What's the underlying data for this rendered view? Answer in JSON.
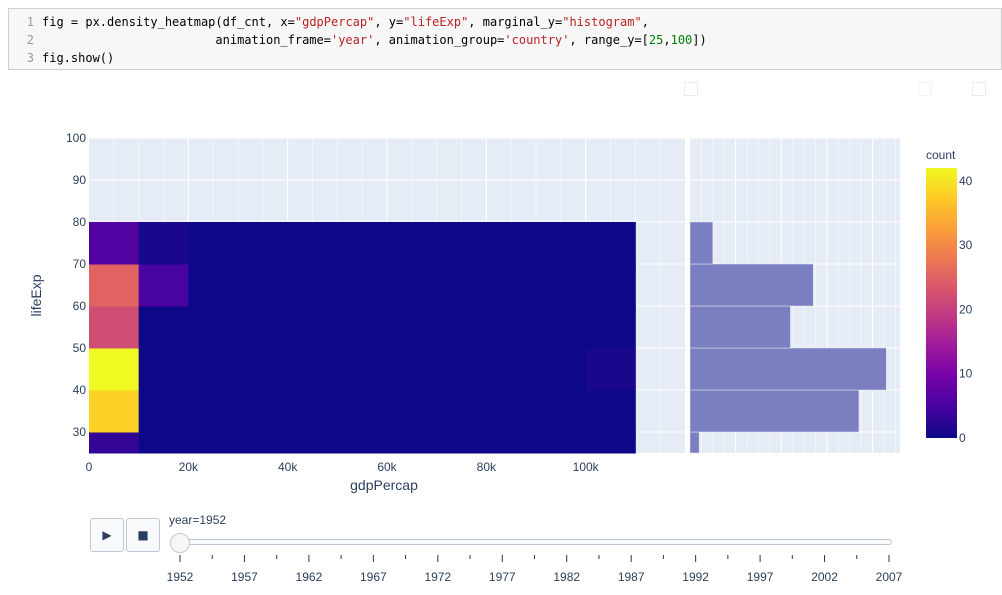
{
  "code_cell": {
    "line_numbers": [
      "1",
      "2",
      "3"
    ],
    "lines": [
      [
        {
          "t": "fig = px.density_heatmap(df_cnt, x="
        },
        {
          "t": "\"gdpPercap\"",
          "c": "str"
        },
        {
          "t": ", y="
        },
        {
          "t": "\"lifeExp\"",
          "c": "str"
        },
        {
          "t": ", marginal_y="
        },
        {
          "t": "\"histogram\"",
          "c": "str"
        },
        {
          "t": ","
        }
      ],
      [
        {
          "t": "                        animation_frame="
        },
        {
          "t": "'year'",
          "c": "str"
        },
        {
          "t": ", animation_group="
        },
        {
          "t": "'country'",
          "c": "str"
        },
        {
          "t": ", range_y=["
        },
        {
          "t": "25",
          "c": "num"
        },
        {
          "t": ","
        },
        {
          "t": "100",
          "c": "num"
        },
        {
          "t": "])"
        }
      ],
      [
        {
          "t": "fig.show()"
        }
      ]
    ]
  },
  "colors": {
    "plot_bg": "#e5ecf6",
    "grid": "#ffffff",
    "text": "#2a3f5f",
    "histogram_bar": "#7b7ec0",
    "colorscale": [
      "#0d0887",
      "#46039f",
      "#7201a8",
      "#9c179e",
      "#bd3786",
      "#d8576b",
      "#ed7953",
      "#fb9f3a",
      "#fdca26",
      "#f0f921"
    ]
  },
  "chart_data": {
    "type": "heatmap",
    "subtype": "density_heatmap with marginal histogram",
    "frame": "year=1952",
    "xlabel": "gdpPercap",
    "ylabel": "lifeExp",
    "xlim": [
      0,
      120000
    ],
    "ylim": [
      25,
      100
    ],
    "x_ticks": [
      {
        "v": 0,
        "label": "0"
      },
      {
        "v": 20000,
        "label": "20k"
      },
      {
        "v": 40000,
        "label": "40k"
      },
      {
        "v": 60000,
        "label": "60k"
      },
      {
        "v": 80000,
        "label": "80k"
      },
      {
        "v": 100000,
        "label": "100k"
      }
    ],
    "y_ticks": [
      {
        "v": 30,
        "label": "30"
      },
      {
        "v": 40,
        "label": "40"
      },
      {
        "v": 50,
        "label": "50"
      },
      {
        "v": 60,
        "label": "60"
      },
      {
        "v": 70,
        "label": "70"
      },
      {
        "v": 80,
        "label": "80"
      },
      {
        "v": 90,
        "label": "90"
      },
      {
        "v": 100,
        "label": "100"
      }
    ],
    "x_bin_edges": [
      0,
      10000,
      20000,
      30000,
      40000,
      50000,
      60000,
      70000,
      80000,
      90000,
      100000,
      110000
    ],
    "y_bin_edges": [
      25,
      30,
      40,
      50,
      60,
      70,
      80
    ],
    "z_rows_bottom_to_top": [
      [
        3,
        0,
        0,
        0,
        0,
        0,
        0,
        0,
        0,
        0,
        0
      ],
      [
        38,
        0,
        0,
        0,
        0,
        0,
        0,
        0,
        0,
        0,
        0
      ],
      [
        42,
        0,
        0,
        0,
        0,
        0,
        0,
        0,
        0,
        0,
        1
      ],
      [
        22,
        0,
        0,
        0,
        0,
        0,
        0,
        0,
        0,
        0,
        0
      ],
      [
        25,
        5,
        0,
        0,
        0,
        0,
        0,
        0,
        0,
        0,
        0
      ],
      [
        6,
        1,
        0,
        0,
        0,
        0,
        0,
        0,
        0,
        0,
        0
      ]
    ],
    "zlim": [
      0,
      42
    ],
    "colorbar": {
      "title": "count",
      "ticks": [
        {
          "v": 0,
          "label": "0"
        },
        {
          "v": 10,
          "label": "10"
        },
        {
          "v": 20,
          "label": "20"
        },
        {
          "v": 30,
          "label": "30"
        },
        {
          "v": 40,
          "label": "40"
        }
      ]
    },
    "marginal_histogram": {
      "bin_edges": [
        25,
        30,
        40,
        50,
        60,
        70,
        80
      ],
      "counts": [
        2,
        37,
        43,
        22,
        27,
        5
      ],
      "xlim": [
        0,
        46
      ],
      "grid": [
        10,
        20,
        30,
        40
      ]
    }
  },
  "animation": {
    "play_glyph": "▶",
    "stop_glyph": "■",
    "current_label": "year=1952",
    "frames": [
      "1952",
      "1957",
      "1962",
      "1967",
      "1972",
      "1977",
      "1982",
      "1987",
      "1992",
      "1997",
      "2002",
      "2007"
    ],
    "active_index": 0
  }
}
